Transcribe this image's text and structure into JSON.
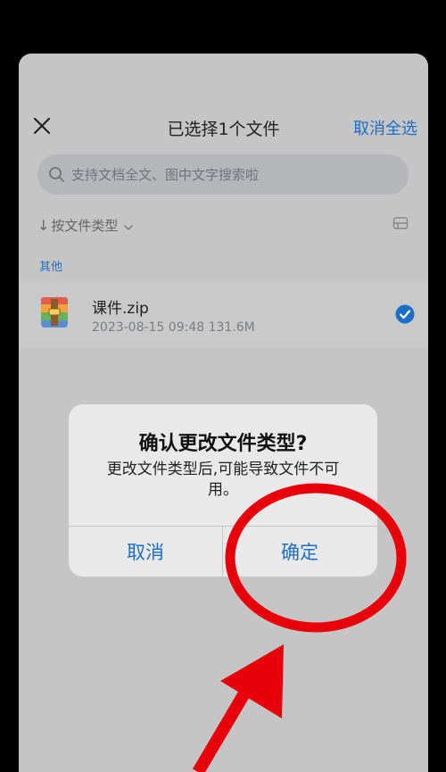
{
  "header": {
    "title": "已选择1个文件",
    "cancel_all_label": "取消全选"
  },
  "search": {
    "placeholder": "支持文档全文、图中文字搜索啦"
  },
  "sort": {
    "arrow": "↓",
    "label": "按文件类型"
  },
  "section": {
    "label": "其他"
  },
  "file": {
    "name": "课件.zip",
    "meta": "2023-08-15 09:48   131.6M",
    "selected": true
  },
  "dialog": {
    "title": "确认更改文件类型?",
    "message": "更改文件类型后,可能导致文件不可用。",
    "cancel_label": "取消",
    "confirm_label": "确定"
  },
  "colors": {
    "accent": "#1b6fc7",
    "annotation_red": "#e8000b"
  },
  "icons": {
    "close": "close-icon",
    "search": "search-icon",
    "chevron": "chevron-down-icon",
    "view": "view-toggle-icon",
    "file": "archive-file-icon",
    "check": "checkmark-icon"
  }
}
